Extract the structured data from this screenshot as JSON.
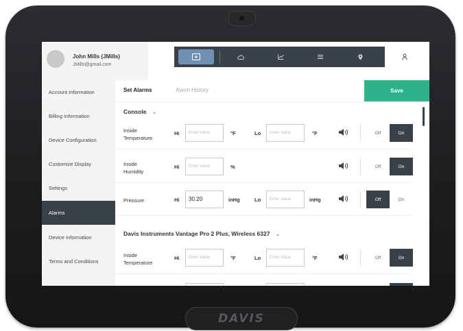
{
  "device": {
    "logo": "DAVIS"
  },
  "user": {
    "name": "John Mills (JMills)",
    "email": "JMills@gmail.com"
  },
  "sidebar": {
    "items": [
      {
        "label": "Account Information"
      },
      {
        "label": "Billing Information"
      },
      {
        "label": "Device Configuration"
      },
      {
        "label": "Customize Display"
      },
      {
        "label": "Settings"
      },
      {
        "label": "Alarms"
      },
      {
        "label": "Device Information"
      },
      {
        "label": "Terms and Conditions"
      }
    ],
    "active": "Alarms"
  },
  "tabs": [
    {
      "icon": "dashboard-icon"
    },
    {
      "icon": "cloud-icon"
    },
    {
      "icon": "chart-icon"
    },
    {
      "icon": "list-icon"
    },
    {
      "icon": "location-pin-icon"
    },
    {
      "icon": "user-icon"
    }
  ],
  "toolbar": {
    "tab_active": "Set Alarms",
    "tab_history": "Alarm History",
    "save_label": "Save"
  },
  "sections": [
    {
      "title": "Console",
      "rows": [
        {
          "label_line1": "Inside",
          "label_line2": "Temperature",
          "hi_label": "Hi",
          "hi_value": "",
          "hi_placeholder": "Enter Value",
          "hi_unit": "°F",
          "lo_label": "Lo",
          "lo_value": "",
          "lo_placeholder": "Enter Value",
          "lo_unit": "°F",
          "off": "Off",
          "on": "On",
          "state": "on"
        },
        {
          "label_line1": "Inside",
          "label_line2": "Humidity",
          "hi_label": "Hi",
          "hi_value": "",
          "hi_placeholder": "Enter Value",
          "hi_unit": "%",
          "off": "Off",
          "on": "On",
          "state": "on"
        },
        {
          "label": "Pressure",
          "hi_label": "Hi",
          "hi_value": "30.20",
          "hi_unit": "inHg",
          "lo_label": "Lo",
          "lo_value": "",
          "lo_placeholder": "Enter Value",
          "lo_unit": "inHg",
          "off": "Off",
          "on": "On",
          "state": "off"
        }
      ]
    },
    {
      "title": "Davis Instruments Vantage Pro 2 Plus, Wireless 6327",
      "rows": [
        {
          "label_line1": "Inside",
          "label_line2": "Temperature",
          "hi_label": "Hi",
          "hi_value": "",
          "hi_placeholder": "Enter Value",
          "hi_unit": "°F",
          "lo_label": "Lo",
          "lo_value": "",
          "lo_placeholder": "Enter Value",
          "lo_unit": "°F",
          "off": "Off",
          "on": "On",
          "state": "on"
        }
      ]
    }
  ],
  "colors": {
    "dark": "#3b4149",
    "accent": "#2db38a",
    "active_tab": "#6f8fb3"
  }
}
